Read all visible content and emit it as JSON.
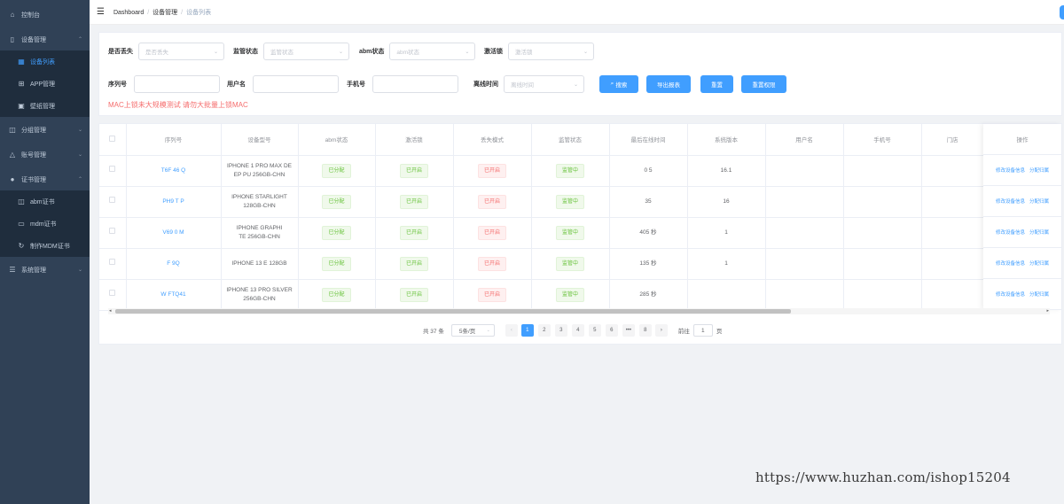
{
  "sidebar": {
    "items": [
      {
        "label": "控制台",
        "icon": "home-icon",
        "level": 1,
        "chevron": ""
      },
      {
        "label": "设备管理",
        "icon": "phone-icon",
        "level": 1,
        "chevron": "^"
      },
      {
        "label": "设备列表",
        "icon": "grid-icon",
        "level": 2,
        "active": true
      },
      {
        "label": "APP管理",
        "icon": "app-icon",
        "level": 2
      },
      {
        "label": "壁纸管理",
        "icon": "image-icon",
        "level": 2
      },
      {
        "label": "分组管理",
        "icon": "book-icon",
        "level": 1,
        "chevron": "v"
      },
      {
        "label": "账号管理",
        "icon": "user-outline-icon",
        "level": 1,
        "chevron": "v"
      },
      {
        "label": "证书管理",
        "icon": "person-icon",
        "level": 1,
        "chevron": "^"
      },
      {
        "label": "abm证书",
        "icon": "book-open-icon",
        "level": 2
      },
      {
        "label": "mdm证书",
        "icon": "folder-icon",
        "level": 2
      },
      {
        "label": "制作MDM证书",
        "icon": "refresh-icon",
        "level": 2
      },
      {
        "label": "系统管理",
        "icon": "sliders-icon",
        "level": 1,
        "chevron": "v"
      }
    ]
  },
  "header": {
    "breadcrumb": [
      "Dashboard",
      "设备管理",
      "设备列表"
    ]
  },
  "filters": {
    "row1": [
      {
        "label": "是否丢失",
        "placeholder": "是否丢失"
      },
      {
        "label": "监管状态",
        "placeholder": "监管状态"
      },
      {
        "label": "abm状态",
        "placeholder": "abm状态"
      },
      {
        "label": "激活锁",
        "placeholder": "激活锁"
      }
    ],
    "row2": [
      {
        "label": "序列号"
      },
      {
        "label": "用户名"
      },
      {
        "label": "手机号"
      },
      {
        "label": "离线时间",
        "placeholder": "离线时间"
      }
    ],
    "buttons": [
      "搜索",
      "导出报表",
      "重置",
      "重置权限"
    ],
    "warning": "MAC上锁未大规模测试 请勿大批量上锁MAC"
  },
  "table": {
    "headers": [
      "序列号",
      "设备型号",
      "abm状态",
      "激活锁",
      "丢失模式",
      "监管状态",
      "最后在线时间",
      "系统版本",
      "用户名",
      "手机号",
      "门店",
      "操作"
    ],
    "rows": [
      {
        "serial": "T6F  46  Q",
        "model": [
          "IPHONE 1  PRO MAX DE",
          "EP PU  256GB-CHN"
        ],
        "abm": "已分配",
        "lock": "已开启",
        "lost": "已开启",
        "supervised": "监管中",
        "last": "0   5",
        "os": "16.1"
      },
      {
        "serial": "PH9   T  P",
        "model": [
          "IPHONE   STARLIGHT",
          "128GB-CHN"
        ],
        "abm": "已分配",
        "lock": "已开启",
        "lost": "已开启",
        "supervised": "监管中",
        "last": "35",
        "os": "16"
      },
      {
        "serial": "V69   0   M",
        "model": [
          "IPHONE   GRAPHI",
          "TE 256GB-CHN"
        ],
        "abm": "已分配",
        "lock": "已开启",
        "lost": "已开启",
        "supervised": "监管中",
        "last": "405   秒",
        "os": "1"
      },
      {
        "serial": "F   9Q",
        "model": [
          "IPHONE 13   E 128GB",
          ""
        ],
        "abm": "已分配",
        "lock": "已开启",
        "lost": "已开启",
        "supervised": "监管中",
        "last": "135   秒",
        "os": "1"
      },
      {
        "serial": "W   FTQ41",
        "model": [
          "IPHONE 13 PRO SILVER",
          "256GB-CHN"
        ],
        "abm": "已分配",
        "lock": "已开启",
        "lost": "已开启",
        "supervised": "监管中",
        "last": "285   秒",
        "os": ""
      }
    ],
    "op_labels": [
      "修改设备信息",
      "分配归属"
    ]
  },
  "pagination": {
    "total": "共 37 条",
    "size": "5条/页",
    "pages": [
      "1",
      "2",
      "3",
      "4",
      "5",
      "6",
      "•••",
      "8"
    ],
    "goto_prefix": "前往",
    "goto_value": "1",
    "goto_suffix": "页"
  },
  "watermark": "https://www.huzhan.com/ishop15204"
}
